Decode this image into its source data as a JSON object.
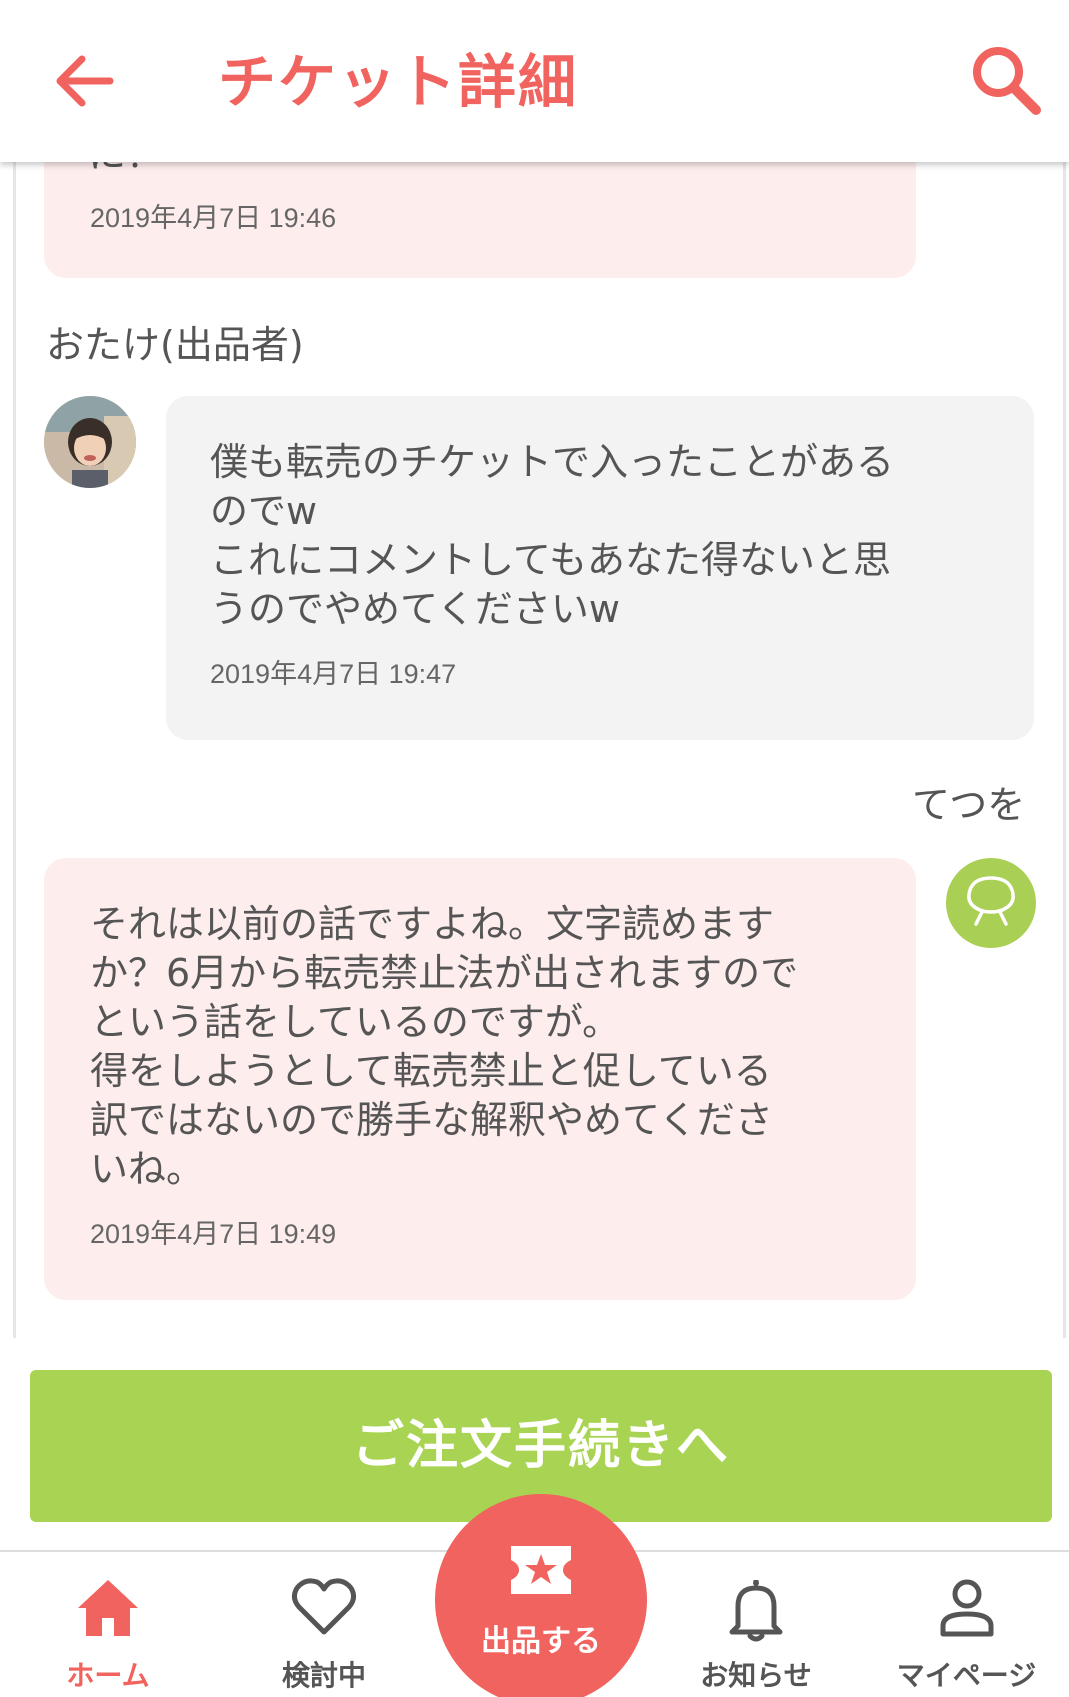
{
  "header": {
    "title": "チケット詳細"
  },
  "messages": [
    {
      "id": "prev",
      "text": "に？",
      "time": "2019年4月7日 19:46"
    },
    {
      "id": "seller",
      "sender": "おたけ(出品者)",
      "text": "僕も転売のチケットで入ったことがある\nのでw\nこれにコメントしてもあなた得ないと思\nうのでやめてくださいw",
      "time": "2019年4月7日 19:47"
    },
    {
      "id": "buyer",
      "sender": "てつを",
      "text": "それは以前の話ですよね。文字読めます\nか？6月から転売禁止法が出されますので\nという話をしているのですが。\n得をしようとして転売禁止と促している\n訳ではないので勝手な解釈やめてくださ\nいね。",
      "time": "2019年4月7日 19:49"
    }
  ],
  "order_button": {
    "label": "ご注文手続きへ"
  },
  "nav": {
    "items": [
      {
        "label": "ホーム",
        "icon": "home-icon",
        "active": true
      },
      {
        "label": "検討中",
        "icon": "heart-icon",
        "active": false
      },
      {
        "label": "出品する",
        "icon": "ticket-star-icon",
        "active": false
      },
      {
        "label": "お知らせ",
        "icon": "bell-icon",
        "active": false
      },
      {
        "label": "マイページ",
        "icon": "person-icon",
        "active": false
      }
    ]
  },
  "colors": {
    "accent": "#f0635e",
    "order_button": "#a9d453",
    "pink_bubble": "#fdeded",
    "gray_bubble": "#f3f3f3",
    "default_avatar": "#a9cf55"
  }
}
